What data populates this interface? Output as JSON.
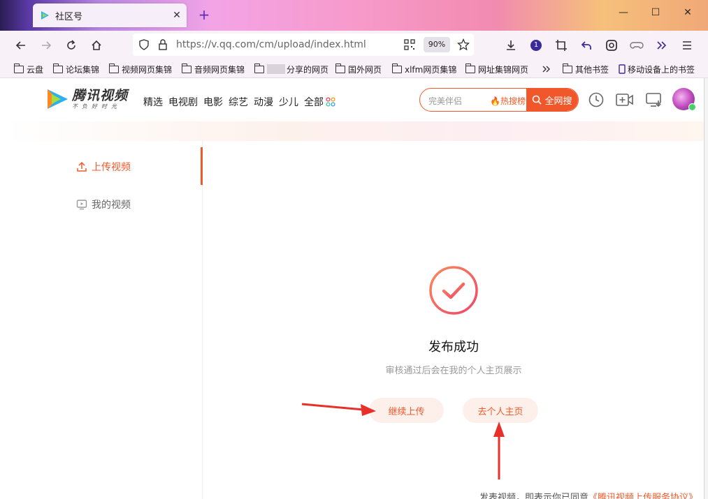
{
  "browser": {
    "tab_title": "社区号",
    "url": "https://v.qq.com/cm/upload/index.html",
    "zoom": "90%",
    "extension_badge": "1"
  },
  "bookmarks": [
    {
      "label": "云盘"
    },
    {
      "label": "论坛集锦"
    },
    {
      "label": "视频网页集锦"
    },
    {
      "label": "音频网页集锦"
    },
    {
      "label": "分享的网页"
    },
    {
      "label": "国外网页"
    },
    {
      "label": "xlfm网页集锦"
    },
    {
      "label": "网址集锦网页"
    },
    {
      "label": "其他书签"
    },
    {
      "label": "移动设备上的书签"
    }
  ],
  "site": {
    "brand": "腾讯视频",
    "slogan": "不负好时光",
    "nav": [
      "精选",
      "电视剧",
      "电影",
      "综艺",
      "动漫",
      "少儿",
      "全部"
    ],
    "search_placeholder": "完美伴侣",
    "hot_label": "热搜榜",
    "search_button": "全网搜"
  },
  "sidebar": {
    "items": [
      {
        "label": "上传视频",
        "active": true
      },
      {
        "label": "我的视频",
        "active": false
      }
    ]
  },
  "result": {
    "title": "发布成功",
    "subtitle": "审核通过后会在我的个人主页展示",
    "continue_button": "继续上传",
    "profile_button": "去个人主页",
    "note_prefix": "发表视频，即表示你已同意",
    "note_link": "《腾讯视频上传服务协议》"
  },
  "colors": {
    "accent": "#f05a2a",
    "annotation_arrow": "#e8302a"
  }
}
